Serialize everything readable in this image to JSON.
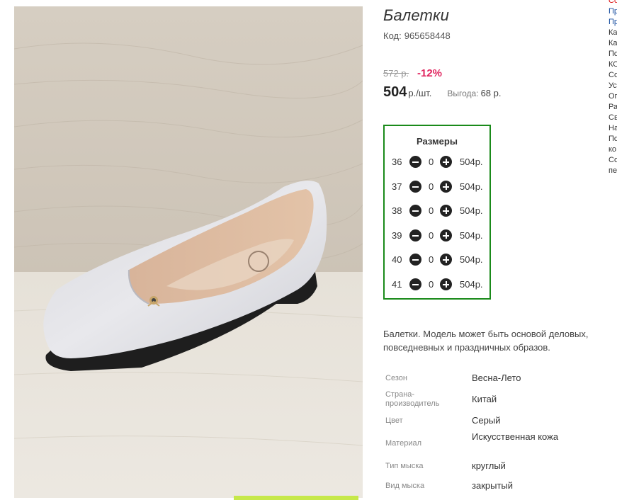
{
  "product": {
    "title": "Балетки",
    "code_label": "Код:",
    "code_value": "965658448",
    "old_price": "572 р.",
    "discount": "-12%",
    "price": "504",
    "price_unit": "р./шт.",
    "benefit_label": "Выгода:",
    "benefit_value": "68 р."
  },
  "sizes": {
    "title": "Размеры",
    "rows": [
      {
        "size": "36",
        "qty": "0",
        "price": "504р."
      },
      {
        "size": "37",
        "qty": "0",
        "price": "504р."
      },
      {
        "size": "38",
        "qty": "0",
        "price": "504р."
      },
      {
        "size": "39",
        "qty": "0",
        "price": "504р."
      },
      {
        "size": "40",
        "qty": "0",
        "price": "504р."
      },
      {
        "size": "41",
        "qty": "0",
        "price": "504р."
      }
    ]
  },
  "description": "Балетки. Модель может быть основой деловых, повседневных и праздничных образов.",
  "attributes": [
    {
      "label": "Сезон",
      "value": "Весна-Лето"
    },
    {
      "label": "Страна-производитель",
      "value": "Китай"
    },
    {
      "label": "Цвет",
      "value": "Серый"
    },
    {
      "label": "Материал",
      "value": "Искусственная кожа"
    },
    {
      "label": "Тип мыска",
      "value": "круглый"
    },
    {
      "label": "Вид мыска",
      "value": "закрытый"
    }
  ],
  "sidebar_fragments": [
    "Со",
    "Пр",
    "Пр",
    "Ка",
    "Ка",
    "По",
    "КО",
    "Со",
    "Ус",
    "Оп",
    "Ра",
    "Св",
    "На",
    "По",
    "ко",
    "Со",
    "пе"
  ],
  "colors": {
    "sizes_border": "#1a8a1a",
    "discount": "#e0245e",
    "link": "#1a4fa0"
  },
  "icons": {
    "minus": "minus-circle-icon",
    "plus": "plus-circle-icon"
  }
}
